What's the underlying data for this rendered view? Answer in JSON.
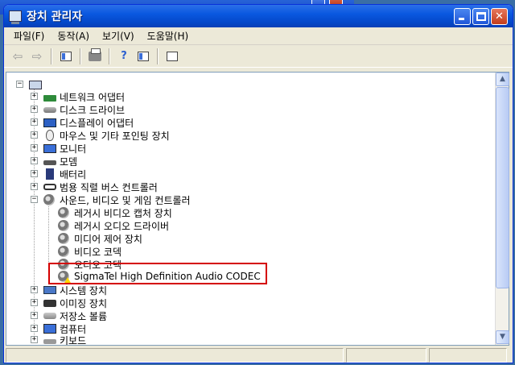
{
  "window": {
    "title": "장치 관리자"
  },
  "menu": [
    {
      "label": "파일(F)"
    },
    {
      "label": "동작(A)"
    },
    {
      "label": "보기(V)"
    },
    {
      "label": "도움말(H)"
    }
  ],
  "tree": {
    "categories": [
      {
        "label": "네트워크 어댑터",
        "icon": "network-adapter-icon"
      },
      {
        "label": "디스크 드라이브",
        "icon": "disk-drive-icon"
      },
      {
        "label": "디스플레이 어댑터",
        "icon": "display-adapter-icon"
      },
      {
        "label": "마우스 및 기타 포인팅 장치",
        "icon": "mouse-icon"
      },
      {
        "label": "모니터",
        "icon": "monitor-icon"
      },
      {
        "label": "모뎀",
        "icon": "modem-icon"
      },
      {
        "label": "배터리",
        "icon": "battery-icon"
      },
      {
        "label": "범용 직렬 버스 컨트롤러",
        "icon": "usb-icon"
      },
      {
        "label": "사운드, 비디오 및 게임 컨트롤러",
        "icon": "sound-icon",
        "expanded": true
      }
    ],
    "sound_children": [
      {
        "label": "레거시 비디오 캡처 장치"
      },
      {
        "label": "레거시 오디오 드라이버"
      },
      {
        "label": "미디어 제어 장치"
      },
      {
        "label": "비디오 코덱"
      },
      {
        "label": "오디오 코덱"
      },
      {
        "label": "SigmaTel High Definition Audio CODEC",
        "warning": true
      }
    ],
    "after": [
      {
        "label": "시스템 장치",
        "icon": "system-device-icon"
      },
      {
        "label": "이미징 장치",
        "icon": "imaging-device-icon"
      },
      {
        "label": "저장소 볼륨",
        "icon": "storage-volume-icon"
      },
      {
        "label": "컴퓨터",
        "icon": "computer-icon"
      },
      {
        "label": "키보드",
        "icon": "keyboard-icon"
      }
    ]
  },
  "colors": {
    "titlebar": "#0a58e0",
    "highlight": "#d40000",
    "window_bg": "#ece9d8"
  }
}
